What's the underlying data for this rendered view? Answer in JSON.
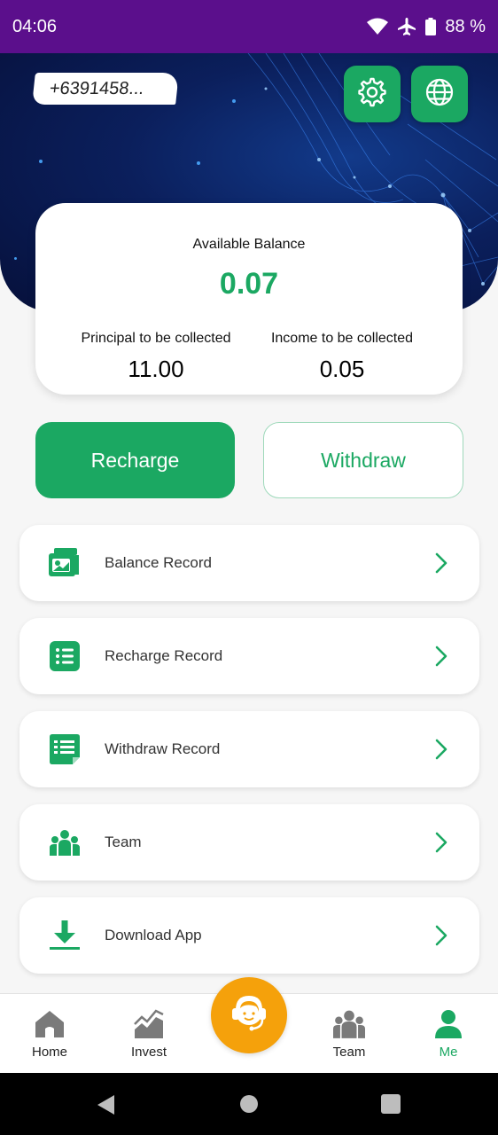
{
  "status_bar": {
    "time": "04:06",
    "battery": "88 %",
    "icons": [
      "wifi-icon",
      "airplane-icon",
      "battery-icon"
    ]
  },
  "header": {
    "user_id": "+6391458...",
    "settings_icon": "gear-icon",
    "language_icon": "globe-icon"
  },
  "balance": {
    "available_label": "Available Balance",
    "available_value": "0.07",
    "principal_label": "Principal to be collected",
    "principal_value": "11.00",
    "income_label": "Income to be collected",
    "income_value": "0.05"
  },
  "actions": {
    "recharge_label": "Recharge",
    "withdraw_label": "Withdraw"
  },
  "menu": [
    {
      "label": "Balance Record",
      "icon": "wallet-icon"
    },
    {
      "label": "Recharge Record",
      "icon": "list-icon"
    },
    {
      "label": "Withdraw Record",
      "icon": "document-list-icon"
    },
    {
      "label": "Team",
      "icon": "team-icon"
    },
    {
      "label": "Download App",
      "icon": "download-icon"
    }
  ],
  "bottom_nav": {
    "items": [
      {
        "label": "Home",
        "icon": "home-icon",
        "active": false
      },
      {
        "label": "Invest",
        "icon": "chart-icon",
        "active": false
      },
      {
        "label": "Team",
        "icon": "team-icon",
        "active": false
      },
      {
        "label": "Me",
        "icon": "user-icon",
        "active": true
      }
    ],
    "support_icon": "headset-icon"
  },
  "colors": {
    "accent": "#1ba862",
    "status_bar": "#5b0f8c",
    "support": "#f5a10b",
    "inactive_icon": "#7a7a7a"
  }
}
